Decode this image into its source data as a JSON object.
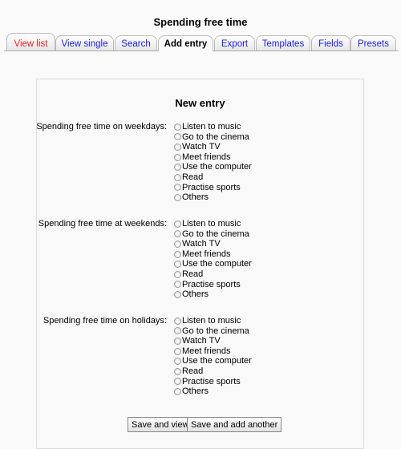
{
  "title": "Spending free time",
  "tabs": [
    {
      "label": "View list"
    },
    {
      "label": "View single"
    },
    {
      "label": "Search"
    },
    {
      "label": "Add entry"
    },
    {
      "label": "Export"
    },
    {
      "label": "Templates"
    },
    {
      "label": "Fields"
    },
    {
      "label": "Presets"
    }
  ],
  "form": {
    "heading": "New entry",
    "groups": [
      {
        "label": "Spending free time on weekdays:",
        "options": [
          "Listen to music",
          "Go to the cinema",
          "Watch TV",
          "Meet friends",
          "Use the computer",
          "Read",
          "Practise sports",
          "Others"
        ]
      },
      {
        "label": "Spending free time at weekends:",
        "options": [
          "Listen to music",
          "Go to the cinema",
          "Watch TV",
          "Meet friends",
          "Use the computer",
          "Read",
          "Practise sports",
          "Others"
        ]
      },
      {
        "label": "Spending free time on holidays:",
        "options": [
          "Listen to music",
          "Go to the cinema",
          "Watch TV",
          "Meet friends",
          "Use the computer",
          "Read",
          "Practise sports",
          "Others"
        ]
      }
    ],
    "save_view": "Save and view",
    "save_add": "Save and add another"
  },
  "colors": {
    "active_link": "#f02020",
    "link": "#1a1aee"
  }
}
